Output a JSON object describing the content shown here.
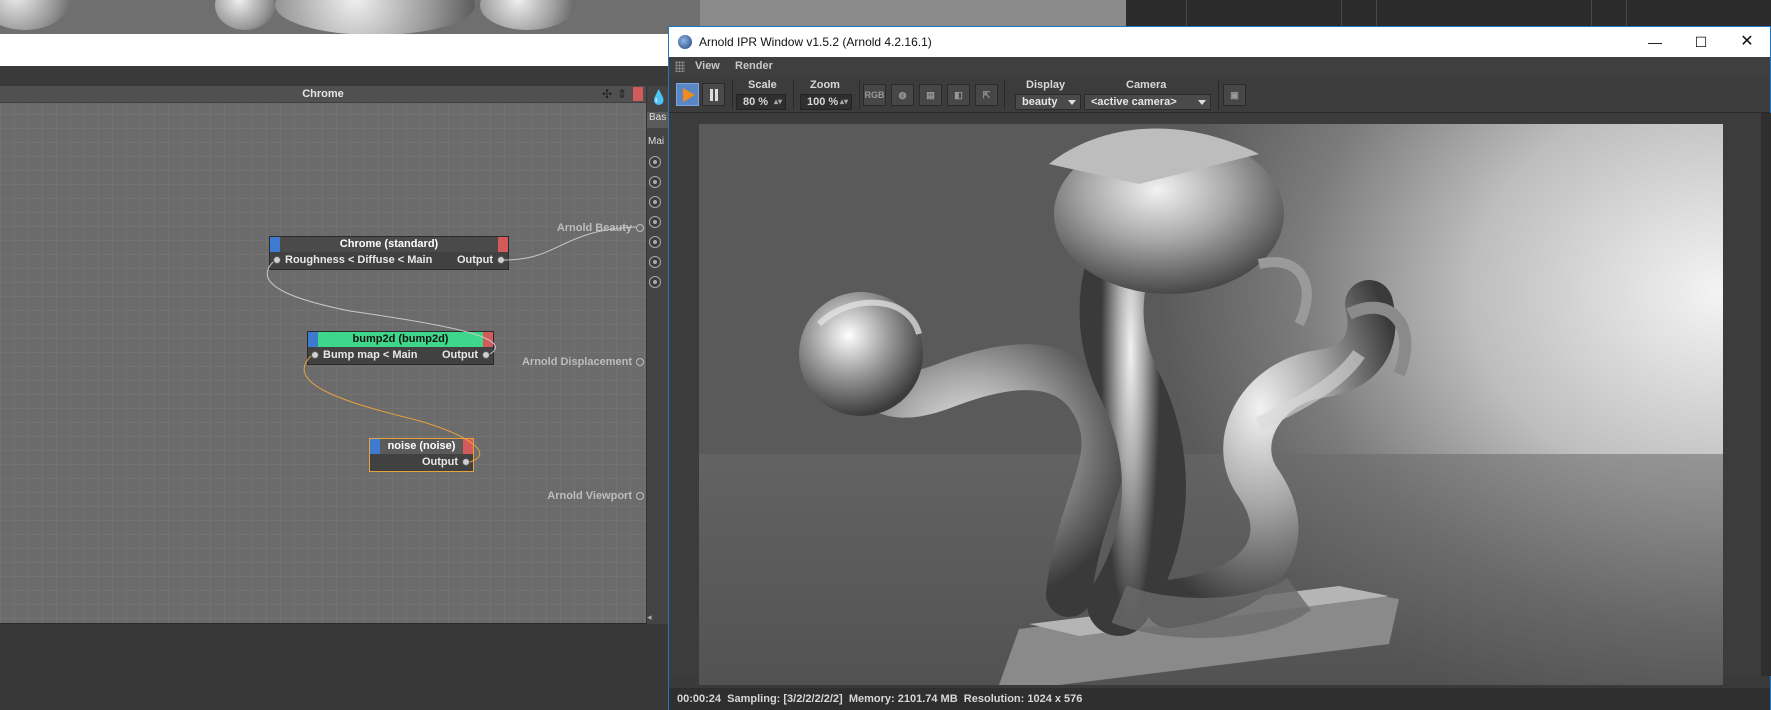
{
  "node_editor": {
    "title": "Chrome",
    "nodes": [
      {
        "title": "Chrome (standard)",
        "input": "Roughness < Diffuse < Main",
        "output": "Output"
      },
      {
        "title": "bump2d (bump2d)",
        "input": "Bump map < Main",
        "output": "Output"
      },
      {
        "title": "noise (noise)",
        "input": "",
        "output": "Output"
      }
    ],
    "terminals": [
      "Arnold Beauty",
      "Arnold Displacement",
      "Arnold Viewport"
    ]
  },
  "attribute_panel": {
    "tab": "Bas",
    "section": "Mai"
  },
  "ipr_window": {
    "title": "Arnold IPR Window v1.5.2 (Arnold 4.2.16.1)",
    "menu": [
      "View",
      "Render"
    ],
    "toolbar": {
      "scale_label": "Scale",
      "scale_value": "80 %",
      "zoom_label": "Zoom",
      "zoom_value": "100 %",
      "rgb_label": "RGB",
      "display_label": "Display",
      "display_value": "beauty",
      "camera_label": "Camera",
      "camera_value": "<active camera>"
    },
    "status": {
      "time": "00:00:24",
      "sampling": "Sampling: [3/2/2/2/2/2]",
      "memory": "Memory: 2101.74 MB",
      "resolution": "Resolution: 1024 x 576"
    },
    "accent_color": "#1e77c7"
  },
  "colors": {
    "node_bump_header": "#3ed68a",
    "node_noise_border": "#e6a23c",
    "port_left_cap": "#3d7ad0",
    "port_right_cap": "#d35a5a",
    "play_icon": "#f08a1e"
  }
}
